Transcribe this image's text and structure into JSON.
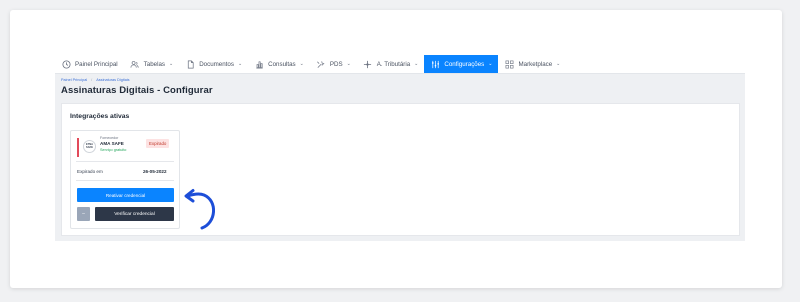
{
  "nav": {
    "items": [
      {
        "label": "Painel Principal",
        "icon": "clock-icon",
        "has_menu": false,
        "active": false
      },
      {
        "label": "Tabelas",
        "icon": "users-icon",
        "has_menu": true,
        "active": false
      },
      {
        "label": "Documentos",
        "icon": "document-icon",
        "has_menu": true,
        "active": false
      },
      {
        "label": "Consultas",
        "icon": "chart-icon",
        "has_menu": true,
        "active": false
      },
      {
        "label": "PDS",
        "icon": "tools-icon",
        "has_menu": true,
        "active": false
      },
      {
        "label": "A. Tributária",
        "icon": "tax-icon",
        "has_menu": true,
        "active": false
      },
      {
        "label": "Configurações",
        "icon": "settings-icon",
        "has_menu": true,
        "active": true
      },
      {
        "label": "Marketplace",
        "icon": "grid-icon",
        "has_menu": true,
        "active": false
      }
    ],
    "chevron": "⌄",
    "active_color": "#0a84ff"
  },
  "breadcrumb": {
    "items": [
      "Painel Principal",
      "Assinaturas Digitais"
    ],
    "separator": "/"
  },
  "page": {
    "title": "Assinaturas Digitais - Configurar"
  },
  "integrations": {
    "title": "Integrações ativas",
    "card": {
      "logo_line1": "ETNA",
      "logo_line2": "SAFE",
      "provider_label": "Fornecedor",
      "provider_name": "AMA SAFE",
      "service_status": "Serviço gratuito",
      "status_badge": "Expirado",
      "expired_label": "Expirado em",
      "expired_date": "26-05-2022",
      "reactivate_button": "Reativar credencial",
      "small_button_icon": "minus-icon",
      "small_button_glyph": "–",
      "verify_button": "Verificar credencial"
    }
  }
}
